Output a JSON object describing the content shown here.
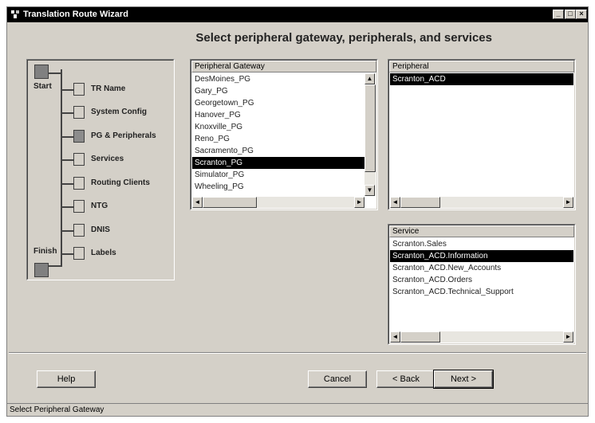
{
  "window": {
    "title": "Translation Route Wizard"
  },
  "heading": "Select peripheral gateway, peripherals, and services",
  "steps": {
    "start_label": "Start",
    "finish_label": "Finish",
    "items": [
      {
        "label": "TR Name",
        "current": false
      },
      {
        "label": "System Config",
        "current": false
      },
      {
        "label": "PG & Peripherals",
        "current": true
      },
      {
        "label": "Services",
        "current": false
      },
      {
        "label": "Routing Clients",
        "current": false
      },
      {
        "label": "NTG",
        "current": false
      },
      {
        "label": "DNIS",
        "current": false
      },
      {
        "label": "Labels",
        "current": false
      }
    ]
  },
  "gateway_list": {
    "header": "Peripheral Gateway",
    "items": [
      "DesMoines_PG",
      "Gary_PG",
      "Georgetown_PG",
      "Hanover_PG",
      "Knoxville_PG",
      "Reno_PG",
      "Sacramento_PG",
      "Scranton_PG",
      "Simulator_PG",
      "Wheeling_PG"
    ],
    "selected": "Scranton_PG"
  },
  "peripheral_list": {
    "header": "Peripheral",
    "items": [
      "Scranton_ACD"
    ],
    "selected": "Scranton_ACD"
  },
  "service_list": {
    "header": "Service",
    "items": [
      "Scranton.Sales",
      "Scranton_ACD.Information",
      "Scranton_ACD.New_Accounts",
      "Scranton_ACD.Orders",
      "Scranton_ACD.Technical_Support"
    ],
    "selected": "Scranton_ACD.Information"
  },
  "buttons": {
    "help": "Help",
    "cancel": "Cancel",
    "back": "< Back",
    "next": "Next >"
  },
  "status": "Select Peripheral Gateway",
  "colors": {
    "selection": "#000000",
    "face": "#d4d0c8"
  }
}
